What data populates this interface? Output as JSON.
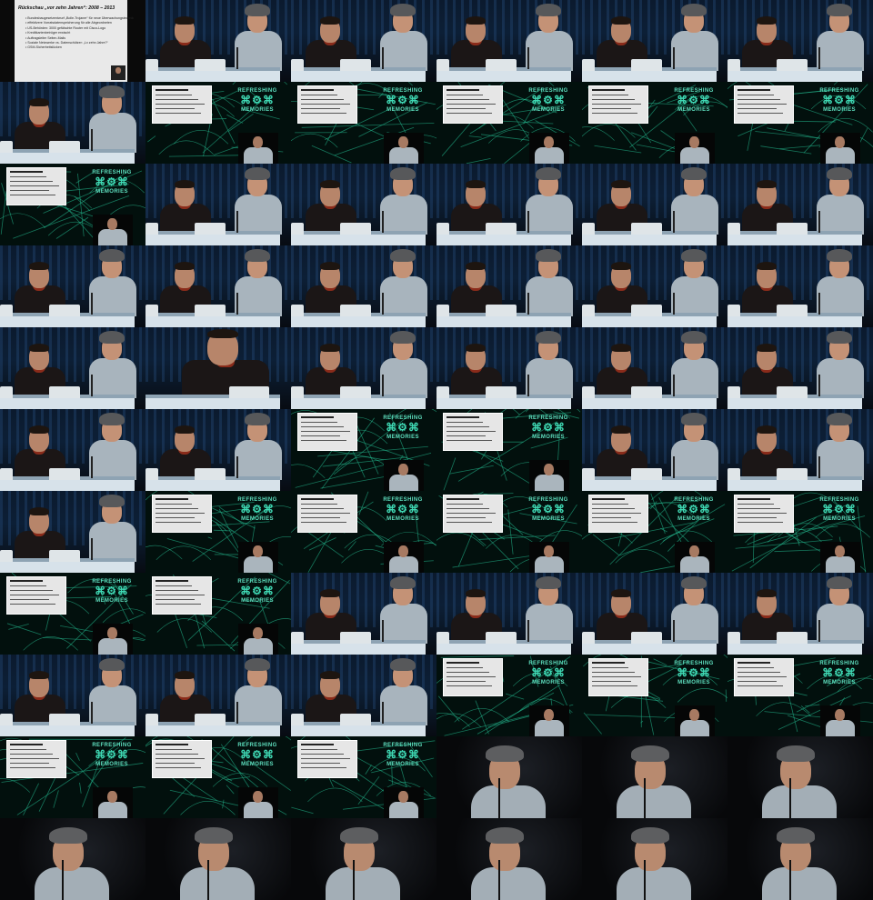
{
  "slide_title": "Rückschau „vor zehn Jahren“: 2008 – 2013",
  "slide_bullets": [
    "Bundesbaugesetzentwurf „Bolle-Trojaner“ für neue Überwachungstechnik",
    "effektivere Vorratsdatenspeicherung für alle Abgeordneten",
    "US-Behörden: 3000 gefälschte Router mit Cisco-Logo",
    "Kreditkartenbetrüger erwischt",
    "Auftragsleiter Seiten-Mails",
    "Soziale Netzwerke vs. Datenschützer: „Lx zehn Jahre?“",
    "GSM-Sicherheitslücken"
  ],
  "logo_line1": "REFRESHING",
  "logo_line2": "MEMORIES",
  "tiles": [
    "slide-full",
    "panel",
    "panel",
    "panel",
    "panel",
    "panel",
    "panel",
    "slide",
    "slide",
    "slide",
    "slide",
    "slide",
    "slide",
    "panel",
    "panel",
    "panel",
    "panel",
    "panel",
    "panel",
    "panel",
    "panel",
    "panel",
    "panel",
    "panel",
    "panel",
    "wide",
    "panel",
    "panel",
    "panel",
    "panel",
    "panel",
    "panel",
    "slide",
    "slide",
    "panel",
    "panel",
    "panel",
    "slide",
    "slide",
    "slide",
    "slide",
    "slide",
    "slide",
    "slide",
    "panel",
    "panel",
    "panel",
    "panel",
    "panel",
    "panel",
    "panel",
    "slide",
    "slide",
    "slide",
    "slide",
    "slide",
    "slide",
    "closeup",
    "closeup",
    "closeup",
    "closeup",
    "closeup",
    "closeup",
    "closeup",
    "closeup",
    "closeup"
  ]
}
